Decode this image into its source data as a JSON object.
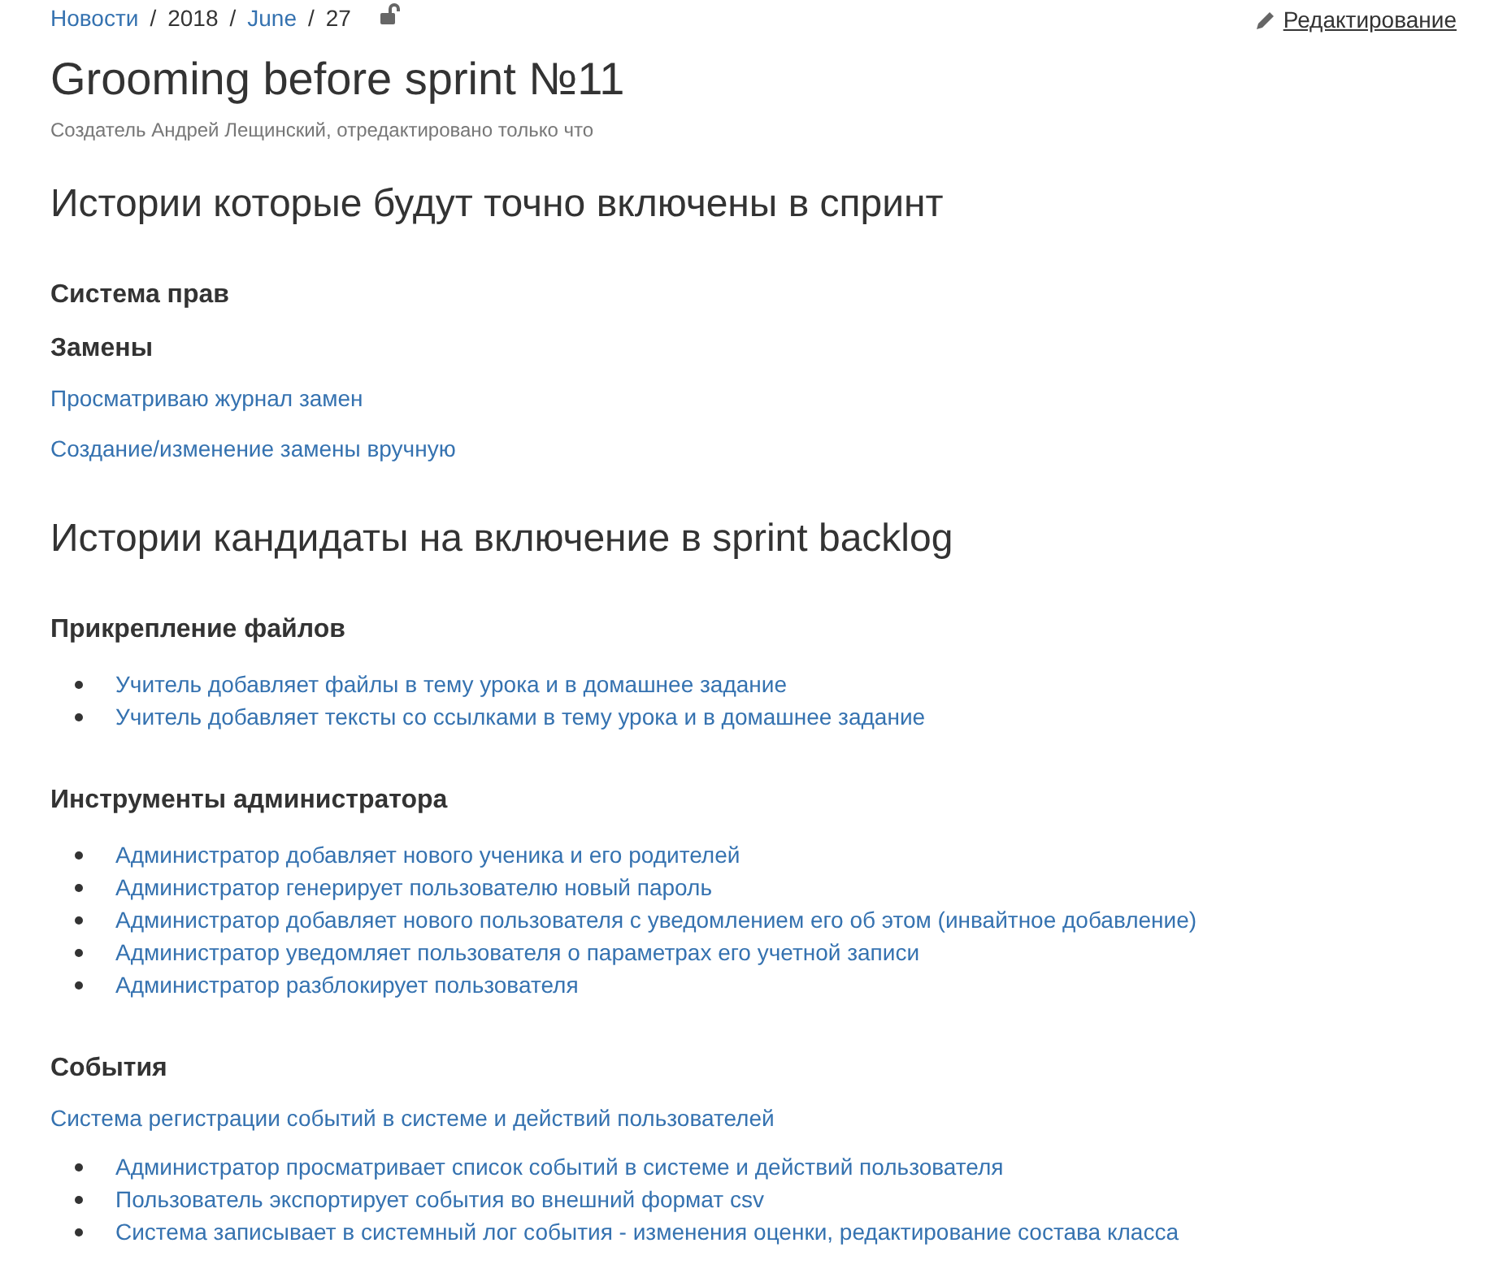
{
  "breadcrumb": [
    {
      "text": "Новости",
      "kind": "link"
    },
    {
      "text": "2018",
      "kind": "text",
      "separator": "/"
    },
    {
      "text": "June",
      "kind": "link",
      "separator": "/"
    },
    {
      "text": "27",
      "kind": "text",
      "separator": "/"
    }
  ],
  "edit_link": "Редактирование",
  "title": "Grooming before sprint №11",
  "byline": "Создатель Андрей Лещинский, отредактировано только что",
  "blocks": [
    {
      "kind": "h2",
      "text": "Истории которые будут точно включены в спринт"
    },
    {
      "kind": "h3",
      "text": "Система прав"
    },
    {
      "kind": "h3",
      "text": "Замены"
    },
    {
      "kind": "link",
      "text": "Просматриваю журнал замен"
    },
    {
      "kind": "link",
      "text": "Создание/изменение замены вручную"
    },
    {
      "kind": "h2",
      "text": "Истории кандидаты на включение в sprint backlog"
    },
    {
      "kind": "h3",
      "text": "Прикрепление файлов"
    },
    {
      "kind": "list",
      "items": [
        "Учитель добавляет файлы в тему урока и в домашнее задание",
        "Учитель добавляет тексты со ссылками в тему урока и в домашнее задание"
      ]
    },
    {
      "kind": "h3",
      "text": "Инструменты администратора"
    },
    {
      "kind": "list",
      "items": [
        "Администратор добавляет нового ученика и его родителей",
        "Администратор генерирует пользователю новый пароль",
        "Администратор добавляет нового пользователя с уведомлением его об этом (инвайтное добавление)",
        "Администратор уведомляет пользователя о параметрах его учетной записи",
        "Администратор разблокирует пользователя"
      ]
    },
    {
      "kind": "h3",
      "text": "События"
    },
    {
      "kind": "link",
      "text": "Система регистрации событий в системе и действий пользователей"
    },
    {
      "kind": "list",
      "items": [
        "Администратор просматривает список событий в системе и действий пользователя",
        "Пользователь экспортирует события во внешний формат csv",
        "Система записывает в системный лог события - изменения оценки, редактирование состава класса"
      ]
    }
  ]
}
